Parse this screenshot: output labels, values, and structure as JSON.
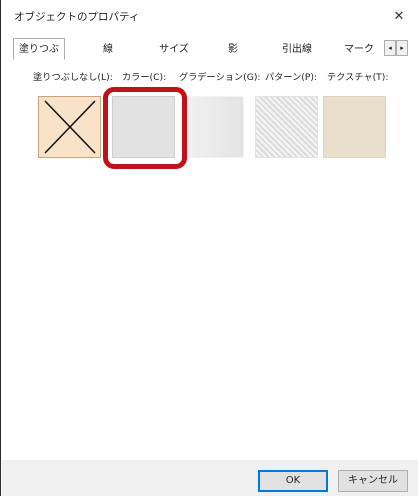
{
  "window": {
    "title": "オブジェクトのプロパティ",
    "close_glyph": "✕"
  },
  "tabs": [
    {
      "label": "塗りつぶし",
      "active": true
    },
    {
      "label": "線"
    },
    {
      "label": "サイズ"
    },
    {
      "label": "影"
    },
    {
      "label": "引出線"
    },
    {
      "label": "マーク"
    }
  ],
  "tab_scroll": {
    "left": "◂",
    "right": "▸"
  },
  "fill": {
    "labels": {
      "none": "塗りつぶしなし(L):",
      "color": "カラー(C):",
      "gradient": "グラデーション(G):",
      "pattern": "パターン(P):",
      "texture": "テクスチャ(T):"
    },
    "selected": "color",
    "highlight_color": "#c0121b"
  },
  "buttons": {
    "ok": "OK",
    "cancel": "キャンセル"
  }
}
